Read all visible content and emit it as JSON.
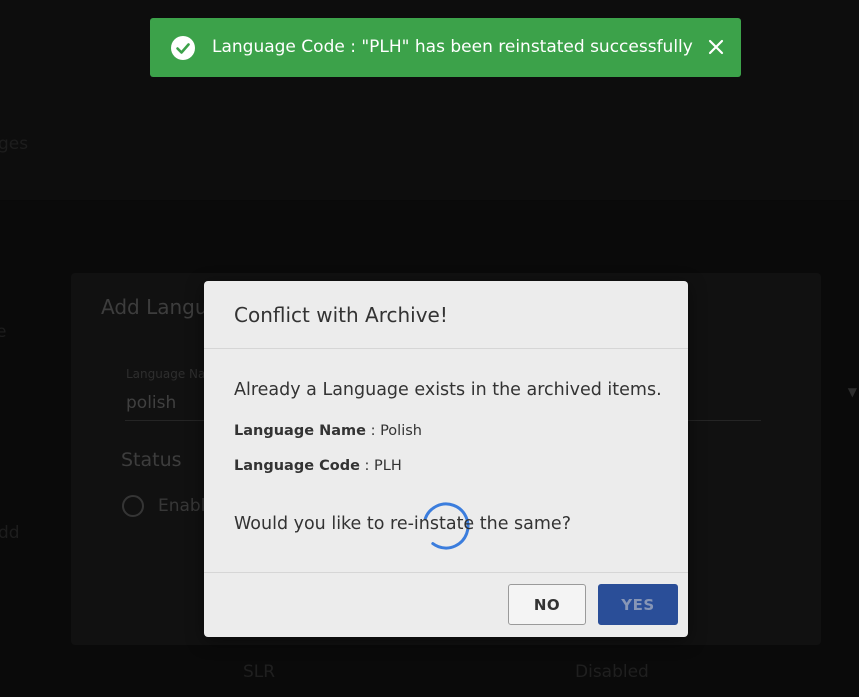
{
  "background": {
    "text_top": "ges",
    "text_mid1": "e",
    "text_mid2": "dd",
    "table_cell_1": "SLR",
    "table_cell_2": "Disabled",
    "dropdown_arrow": "▼"
  },
  "panel": {
    "title": "Add Langua",
    "field_label": "Language Na",
    "field_value": "polish",
    "status_label": "Status",
    "radio_label": "Enabl"
  },
  "dialog": {
    "title": "Conflict with Archive!",
    "message": "Already a Language exists in the archived items.",
    "name_label": "Language Name",
    "name_value": " : Polish",
    "code_label": "Language Code",
    "code_value": " : PLH",
    "question": "Would you like to re-instate the same?",
    "no_label": "NO",
    "yes_label": "YES"
  },
  "toast": {
    "message": "Language Code : \"PLH\" has been reinstated successfully",
    "icon": "check-circle-icon",
    "close_icon": "close-icon",
    "color": "#3ca24a"
  },
  "colors": {
    "primary_button": "#2a4e98",
    "spinner": "#3b7ddd"
  }
}
